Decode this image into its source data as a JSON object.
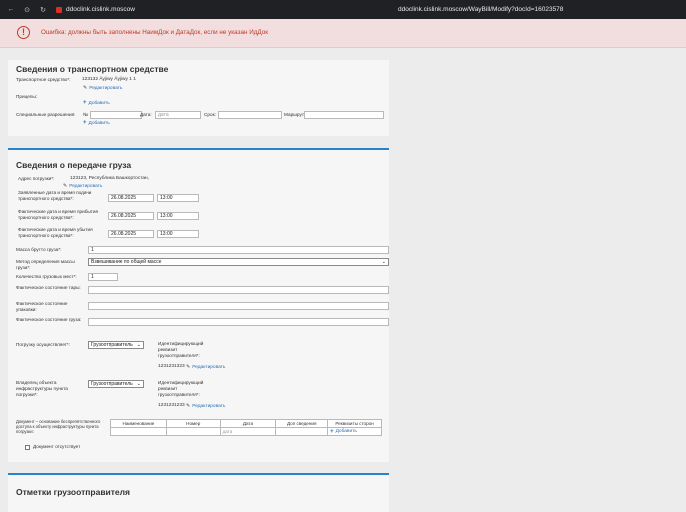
{
  "browser": {
    "host": "ddoclink.cislink.moscow",
    "url": "ddoclink.cislink.moscow/WayBill/Modify?docId=16023578"
  },
  "error": {
    "message": "Ошибка: должны быть заполнены НаимДок и ДатаДок, если не указан ИдДок"
  },
  "transport": {
    "title": "Сведения о транспортном средстве",
    "vehicle_label": "Транспортное средство*:",
    "vehicle_value": "123132 Âyjiwy Âyjiwy 1 1",
    "edit_label": "Редактировать",
    "trailers_label": "Прицепы:",
    "add_label": "Добавить",
    "special_permits_label": "Специальные разрешения:",
    "number_label": "№",
    "date_label": "Дата:",
    "date_placeholder": "дата",
    "term_label": "Срок:",
    "route_label": "Маршрут:"
  },
  "transfer": {
    "title": "Сведения о передаче груза",
    "address_label": "Адрес погрузки*:",
    "address_value": "123123, Республика Башкортостан,",
    "edit_label": "Редактировать",
    "declared_label": "Заявленные дата и время подачи транспортного средства*:",
    "declared_date": "26.08.2025",
    "declared_time": "13:00",
    "arrival_label": "Фактические дата и время прибытия транспортного средства*:",
    "arrival_date": "26.08.2025",
    "arrival_time": "13:00",
    "departure_label": "Фактические дата и время убытия транспортного средства*:",
    "departure_date": "26.08.2025",
    "departure_time": "13:00",
    "gross_label": "Масса брутто груза*:",
    "gross_value": "1",
    "method_label": "Метод определения массы груза*:",
    "method_value": "Взвешивание по общей массе",
    "places_label": "Количество грузовых мест*:",
    "places_value": "1",
    "container_label": "Фактическое состояние тары:",
    "packaging_label": "Фактическое состояние упаковки:",
    "cargo_label": "Фактическое состояние груза:",
    "loading_by_label": "Погрузку осуществляет*:",
    "loading_by_value": "Грузоотправитель",
    "id_req_label": "Идентифицирующий реквизит грузоотправителя*:",
    "id_req_value": "1231231323",
    "owner_label": "Владелец объекта инфраструктуры пункта погрузки*:",
    "owner_value": "Грузоотправитель",
    "id_req2_label": "Идентифицирующий реквизит грузоотправителя*:",
    "id_req2_value": "1231231233",
    "doc_label": "Документ – основание беспрепятственного доступа к объекту инфраструктуры пункта погрузки:",
    "doc_columns": [
      "Наименование",
      "Номер",
      "Дата",
      "Доп сведения",
      "Реквизиты сторон"
    ],
    "doc_date_placeholder": "дата",
    "doc_add_label": "Добавить",
    "doc_absent_label": "Документ отсутствует"
  },
  "shipper_marks": {
    "title": "Отметки грузоотправителя"
  }
}
